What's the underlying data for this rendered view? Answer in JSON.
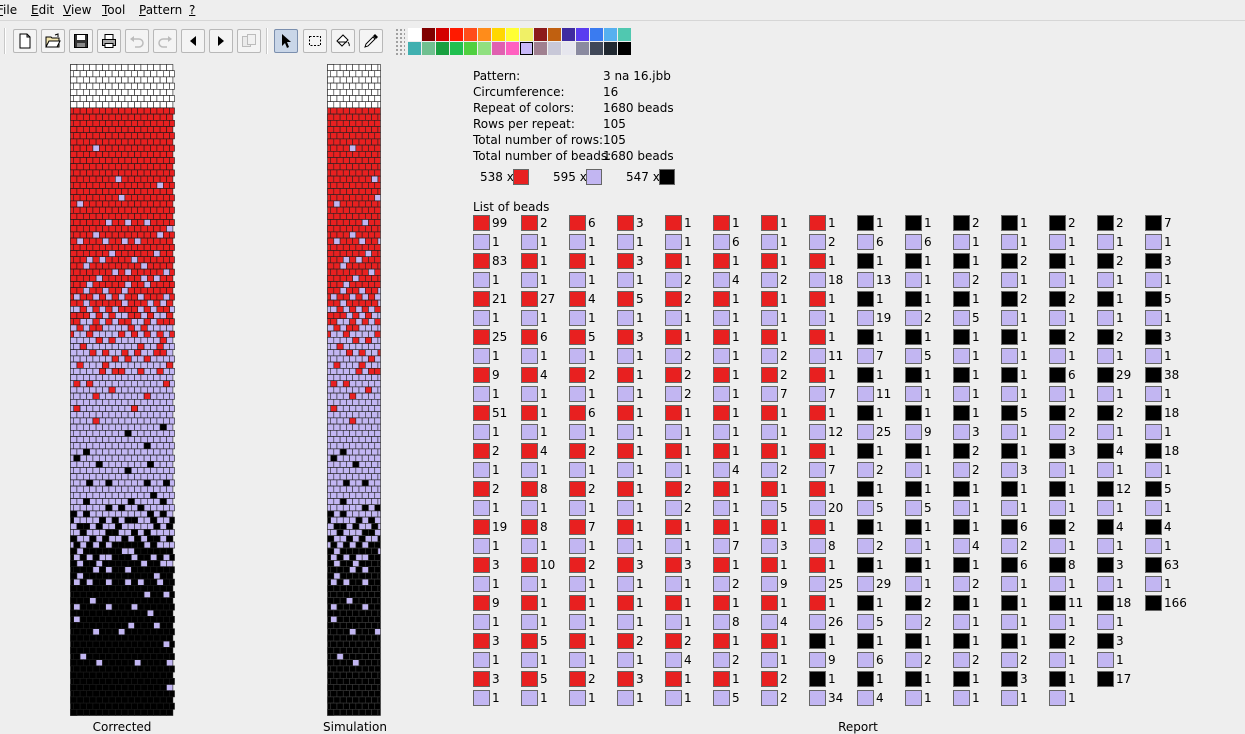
{
  "menu": [
    "File",
    "Edit",
    "View",
    "Tool",
    "Pattern",
    "?"
  ],
  "menu_mnemonic": [
    "F",
    "E",
    "V",
    "T",
    "P",
    "?"
  ],
  "toolbar": {
    "buttons": [
      "new-file-icon",
      "open-folder-icon",
      "save-disk-icon",
      "print-icon",
      "undo-icon",
      "redo-icon",
      "arrow-left-icon",
      "arrow-right-icon",
      "copy-pages-icon",
      "pointer-tool-icon",
      "rectangle-select-icon",
      "fill-bucket-icon",
      "color-picker-icon"
    ]
  },
  "palette": {
    "row1": [
      "#ffffff",
      "#800000",
      "#d40000",
      "#ff1a00",
      "#ff4d1a",
      "#ff8c1a",
      "#ffd700",
      "#ffff33",
      "#f0f066",
      "#8c1a1a",
      "#c06010",
      "#3f2ba0",
      "#5a3cf0",
      "#3a7bf0",
      "#56b0f0",
      "#50c8b0"
    ],
    "row2": [
      "#40b0b0",
      "#70c090",
      "#18a040",
      "#20c050",
      "#50d040",
      "#90e080",
      "#e060b0",
      "#ff60c0",
      "#c8b8f8",
      "#a08090",
      "#c8c8d8",
      "#e6e6ee",
      "#8a8aa0",
      "#404858",
      "#202830",
      "#000000"
    ],
    "selected_index_row2": 8
  },
  "panels": {
    "corrected_label": "Corrected",
    "simulation_label": "Simulation",
    "report_label": "Report"
  },
  "colors": {
    "red": "#e82020",
    "lavender": "#c2b6f2",
    "black": "#000000",
    "white": "#ffffff"
  },
  "report": {
    "info": [
      {
        "label": "Pattern:",
        "value": "3 na 16.jbb"
      },
      {
        "label": "Circumference:",
        "value": "16"
      },
      {
        "label": "Repeat of colors:",
        "value": "1680 beads"
      },
      {
        "label": "Rows per repeat:",
        "value": "105"
      },
      {
        "label": "Total number of rows:",
        "value": "105"
      },
      {
        "label": "Total number of beads:",
        "value": "1680 beads"
      }
    ],
    "counts": [
      {
        "count": "538 x",
        "color": "red"
      },
      {
        "count": "595 x",
        "color": "lavender"
      },
      {
        "count": "547 x",
        "color": "black"
      }
    ],
    "list_title": "List of beads",
    "columns": [
      {
        "c": "RLRLRLRLRLRLRLRLRLRLRLRLRL",
        "n": [
          "99",
          "1",
          "83",
          "1",
          "21",
          "1",
          "25",
          "1",
          "9",
          "1",
          "51",
          "1",
          "2",
          "1",
          "2",
          "1",
          "19",
          "1",
          "3",
          "1",
          "9",
          "1",
          "3",
          "1",
          "3",
          "1"
        ]
      },
      {
        "c": "RLRLRLRLRLRLRLRLRLRLRLRLRL",
        "n": [
          "2",
          "1",
          "1",
          "1",
          "27",
          "1",
          "6",
          "1",
          "4",
          "1",
          "1",
          "1",
          "4",
          "1",
          "8",
          "1",
          "8",
          "1",
          "10",
          "1",
          "1",
          "1",
          "5",
          "1",
          "5",
          "1"
        ]
      },
      {
        "c": "RLRLRLRLRLRLRLRLRLRLRLRLRL",
        "n": [
          "6",
          "1",
          "1",
          "1",
          "4",
          "1",
          "5",
          "1",
          "2",
          "1",
          "6",
          "1",
          "2",
          "1",
          "2",
          "1",
          "7",
          "1",
          "2",
          "1",
          "1",
          "1",
          "1",
          "1",
          "2",
          "1"
        ]
      },
      {
        "c": "RLRLRLRLRLRLRLRLRLRLRLRLRL",
        "n": [
          "3",
          "1",
          "3",
          "1",
          "5",
          "1",
          "3",
          "1",
          "1",
          "1",
          "1",
          "1",
          "1",
          "1",
          "1",
          "1",
          "1",
          "1",
          "3",
          "1",
          "1",
          "1",
          "2",
          "1",
          "3",
          "1"
        ]
      },
      {
        "c": "RLRLRLRLRLRLRLRLRLRLRLRLRL",
        "n": [
          "1",
          "1",
          "1",
          "2",
          "2",
          "1",
          "1",
          "2",
          "2",
          "2",
          "1",
          "1",
          "1",
          "1",
          "2",
          "2",
          "1",
          "1",
          "3",
          "1",
          "1",
          "1",
          "2",
          "4",
          "1",
          "1"
        ]
      },
      {
        "c": "RLRLRLRLRLRLRLRLRLRLRLRLRL",
        "n": [
          "1",
          "6",
          "1",
          "4",
          "1",
          "1",
          "1",
          "1",
          "1",
          "1",
          "1",
          "1",
          "1",
          "4",
          "1",
          "1",
          "1",
          "7",
          "1",
          "2",
          "1",
          "8",
          "1",
          "2",
          "1",
          "5"
        ]
      },
      {
        "c": "RLRLRLRLRLRLRLRLRLRLRLRLRL",
        "n": [
          "1",
          "1",
          "1",
          "2",
          "1",
          "1",
          "1",
          "2",
          "2",
          "7",
          "1",
          "1",
          "1",
          "2",
          "1",
          "5",
          "1",
          "3",
          "1",
          "9",
          "1",
          "4",
          "1",
          "1",
          "2",
          "2"
        ]
      },
      {
        "c": "RLRLRLRLRLRLRLRLRLRLRLBLBL",
        "n": [
          "1",
          "2",
          "1",
          "18",
          "1",
          "1",
          "1",
          "11",
          "1",
          "7",
          "1",
          "12",
          "1",
          "7",
          "1",
          "20",
          "1",
          "8",
          "1",
          "25",
          "1",
          "26",
          "1",
          "9",
          "1",
          "34"
        ]
      },
      {
        "c": "BLBLBLBLBLBLBLBLBLBLBLBLBL",
        "n": [
          "1",
          "6",
          "1",
          "13",
          "1",
          "19",
          "1",
          "7",
          "1",
          "11",
          "1",
          "25",
          "1",
          "2",
          "1",
          "5",
          "1",
          "2",
          "1",
          "29",
          "1",
          "5",
          "1",
          "6",
          "1",
          "4"
        ]
      },
      {
        "c": "BLBLBLBLBLBLBLBLBLBLBLBLBL",
        "n": [
          "1",
          "6",
          "1",
          "1",
          "1",
          "2",
          "1",
          "5",
          "1",
          "1",
          "1",
          "9",
          "1",
          "1",
          "1",
          "5",
          "1",
          "1",
          "1",
          "1",
          "2",
          "2",
          "1",
          "2",
          "1",
          "1"
        ]
      },
      {
        "c": "BLBLBLBLBLBLBLBLBLBLBLBLBL",
        "n": [
          "2",
          "1",
          "1",
          "2",
          "1",
          "5",
          "1",
          "1",
          "1",
          "1",
          "1",
          "3",
          "2",
          "2",
          "1",
          "1",
          "1",
          "4",
          "1",
          "2",
          "1",
          "1",
          "1",
          "2",
          "1",
          "1"
        ]
      },
      {
        "c": "BLBLBLBLBLBLBLBLBLBLBLBLBL",
        "n": [
          "1",
          "1",
          "2",
          "1",
          "2",
          "1",
          "1",
          "1",
          "1",
          "1",
          "5",
          "1",
          "1",
          "3",
          "1",
          "1",
          "6",
          "2",
          "6",
          "1",
          "1",
          "1",
          "1",
          "2",
          "3",
          "1"
        ]
      },
      {
        "c": "BLBLBLBLBLBLBLBLBLBLBLBLBL",
        "n": [
          "2",
          "1",
          "1",
          "1",
          "2",
          "1",
          "2",
          "1",
          "6",
          "1",
          "2",
          "2",
          "3",
          "1",
          "1",
          "1",
          "2",
          "1",
          "8",
          "1",
          "11",
          "1",
          "2",
          "1",
          "1",
          "1"
        ]
      },
      {
        "c": "BLBLBLBLBLBLBLBLBLBLBLBLB",
        "n": [
          "2",
          "1",
          "2",
          "1",
          "1",
          "1",
          "2",
          "1",
          "29",
          "1",
          "2",
          "1",
          "4",
          "1",
          "12",
          "1",
          "4",
          "1",
          "3",
          "1",
          "18",
          "1",
          "3",
          "1",
          "17"
        ]
      },
      {
        "c": "BLBLBLBLBLBLBLBLBLBLB",
        "n": [
          "7",
          "1",
          "3",
          "1",
          "5",
          "1",
          "3",
          "1",
          "38",
          "1",
          "18",
          "1",
          "18",
          "1",
          "5",
          "1",
          "4",
          "1",
          "63",
          "1",
          "166"
        ]
      }
    ]
  }
}
